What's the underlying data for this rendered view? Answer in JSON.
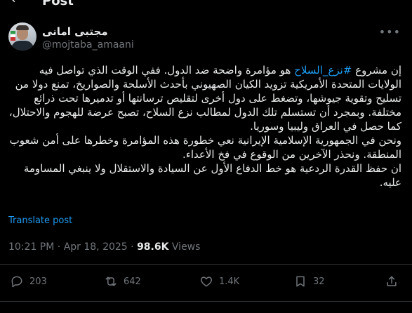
{
  "header": {
    "title": "Post"
  },
  "author": {
    "name": "مجتبی امانی",
    "handle": "@mojtaba_amaani"
  },
  "post": {
    "p1_a": "إن مشروع ",
    "hashtag": "#نزع_السلاح",
    "p1_b": " هو مؤامرة واضحة ضد الدول. ففي الوقت الذي تواصل فيه الولايات المتحدة الأمريكية تزويد الكيان الصهيوني بأحدث الأسلحة والصواريخ، تمنع دولا من تسليح وتقوية جيوشها، وتضغط على دول أخرى لتقليص ترسانتها أو تدميرها تحت ذرائع مختلفة. وبمجرد أن تستسلم تلك الدول لمطالب نزع السلاح، تصبح عرضة للهجوم والاحتلال، كما حصل في العراق وليبيا وسوريا.",
    "p2": "ونحن في الجمهورية الإسلامية الإيرانية نعي خطورة هذه المؤامرة وخطرها على أمن شعوب المنطقة. ونحذر الآخرين من الوقوع في فخ الأعداء.",
    "p3": "ان حفظ القدرة الردعية هو خط الدفاع الأول عن السيادة والاستقلال ولا ينبغي المساومة عليه."
  },
  "translate_label": "Translate post",
  "meta": {
    "time": "10:21 PM",
    "sep": " · ",
    "date": "Apr 18, 2025",
    "sep2": " · ",
    "views_count": "98.6K",
    "views_label": " Views"
  },
  "actions": {
    "replies": "203",
    "reposts": "642",
    "likes": "1.4K",
    "bookmarks": "32"
  },
  "icons": [
    "back-arrow-icon",
    "more-icon",
    "reply-icon",
    "retweet-icon",
    "heart-icon",
    "bookmark-icon",
    "share-icon"
  ],
  "colors": {
    "accent": "#1d9bf0",
    "text": "#e7e9ea",
    "muted": "#71767b",
    "background": "#000000"
  }
}
